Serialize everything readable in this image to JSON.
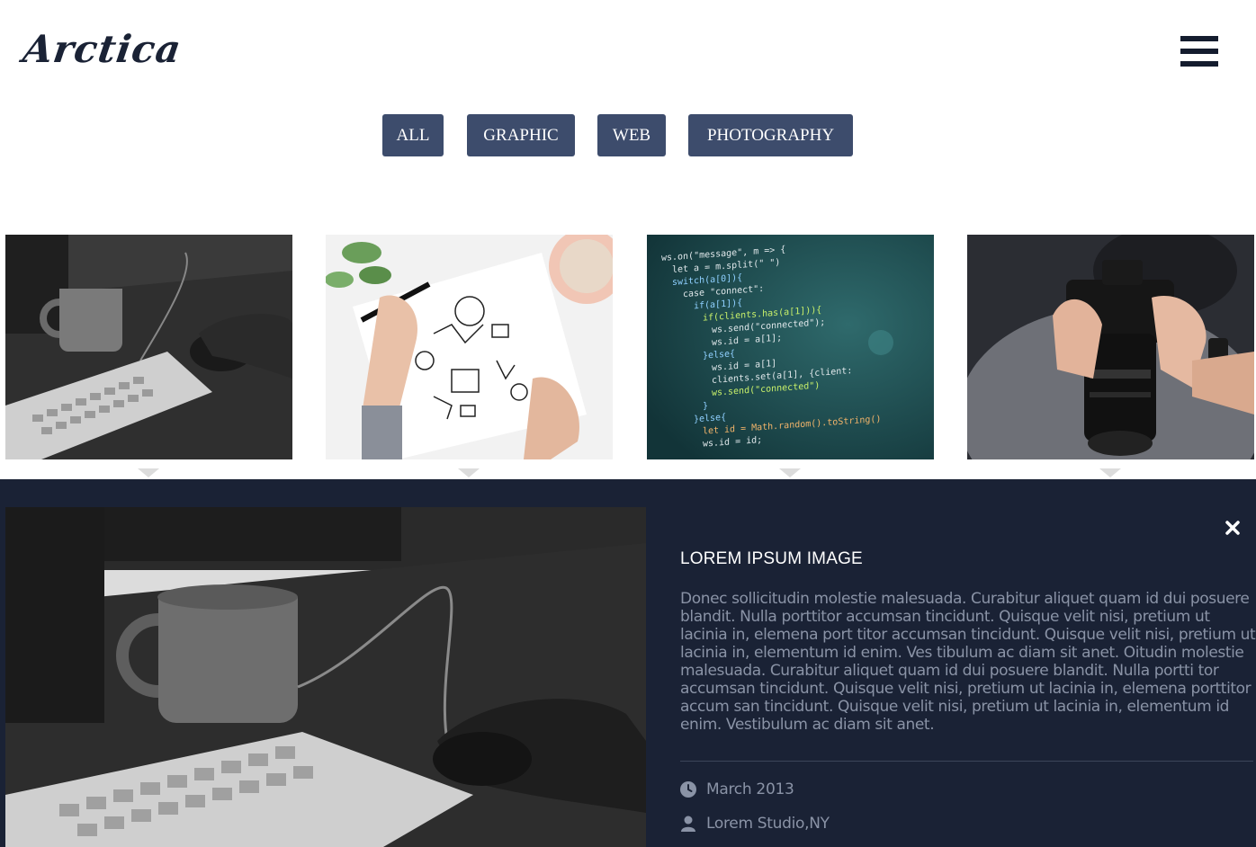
{
  "brand": {
    "logo": "Arctica"
  },
  "header": {
    "menu_icon": "hamburger-menu-icon"
  },
  "filters": [
    {
      "label": "ALL"
    },
    {
      "label": "GRAPHIC"
    },
    {
      "label": "WEB"
    },
    {
      "label": "PHOTOGRAPHY"
    }
  ],
  "portfolio": {
    "items": [
      {
        "subject": "grayscale desk with mug, keyboard and mouse"
      },
      {
        "subject": "hands sketching business doodles in notebook"
      },
      {
        "subject": "code editor screen"
      },
      {
        "subject": "hands holding a camera"
      }
    ]
  },
  "detail": {
    "title": "LOREM IPSUM IMAGE",
    "description": "Donec sollicitudin molestie malesuada. Curabitur aliquet quam id dui posuere blandit. Nulla porttitor accumsan tincidunt. Quisque velit nisi, pretium ut lacinia in, elemena port titor accumsan tincidunt. Quisque velit nisi, pretium ut lacinia in, elementum id enim. Ves tibulum ac diam sit anet. Oitudin molestie malesuada. Curabitur aliquet quam id dui posuere blandit. Nulla portti tor accumsan tincidunt. Quisque velit nisi, pretium ut lacinia in, elemena porttitor accum san tincidunt. Quisque velit nisi, pretium ut lacinia in, elementum id enim. Vestibulum ac diam sit anet.",
    "date": "March 2013",
    "studio": "Lorem Studio,NY",
    "close_icon": "close-icon"
  },
  "colors": {
    "navy": "#1a2235",
    "button": "#3d4c6c",
    "muted_text": "#8a93a6"
  }
}
